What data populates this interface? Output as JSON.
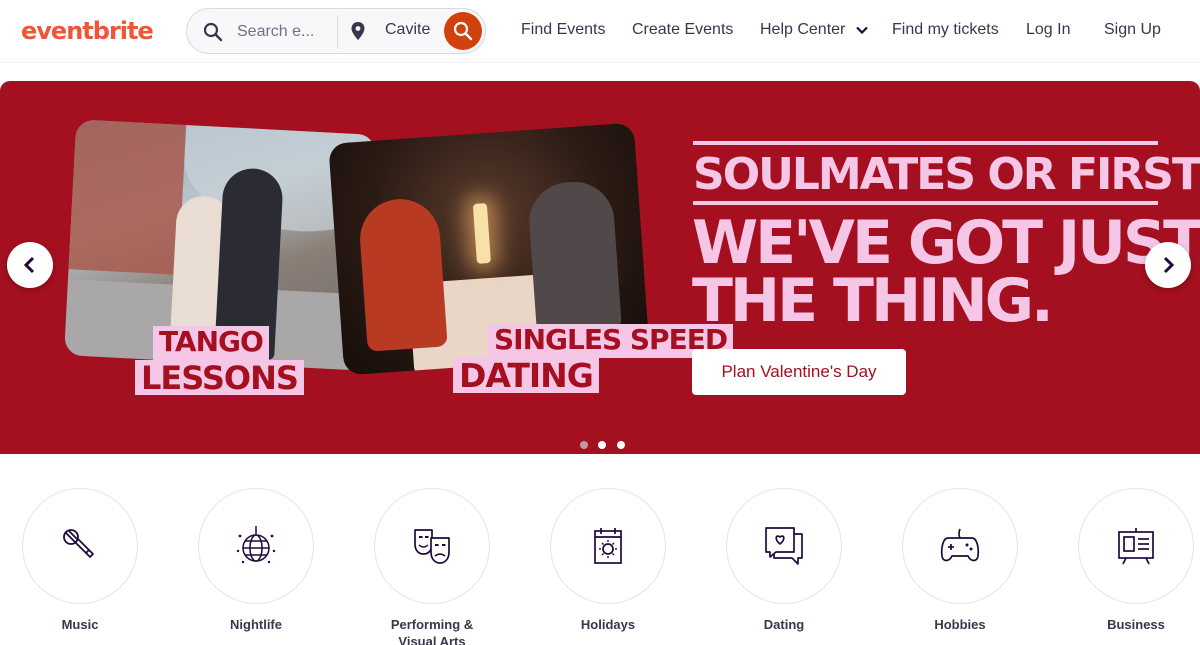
{
  "header": {
    "logo": "eventbrite",
    "search": {
      "placeholder": "Search e...",
      "location": "Cavite"
    },
    "nav": [
      {
        "label": "Find Events"
      },
      {
        "label": "Create Events"
      },
      {
        "label": "Help Center",
        "icon": "chevron-down-icon"
      },
      {
        "label": "Find my tickets"
      },
      {
        "label": "Log In"
      },
      {
        "label": "Sign Up"
      }
    ]
  },
  "hero": {
    "headline_top": "SOULMATES OR FIRST DATES",
    "headline_line1": "WE'VE GOT JUST",
    "headline_line2": "THE THING.",
    "stickers": {
      "tango_1": "TANGO",
      "tango_2": "LESSONS",
      "speed_1": "SINGLES SPEED",
      "speed_2": "DATING"
    },
    "cta_label": "Plan Valentine's Day",
    "slide_count": 3,
    "active_slide": 2
  },
  "categories": [
    {
      "label": "Music",
      "icon": "microphone-icon"
    },
    {
      "label": "Nightlife",
      "icon": "disco-ball-icon"
    },
    {
      "label": "Performing & Visual Arts",
      "icon": "theater-masks-icon"
    },
    {
      "label": "Holidays",
      "icon": "calendar-sun-icon"
    },
    {
      "label": "Dating",
      "icon": "chat-heart-icon"
    },
    {
      "label": "Hobbies",
      "icon": "gamepad-icon"
    },
    {
      "label": "Business",
      "icon": "presentation-board-icon"
    }
  ],
  "colors": {
    "brand": "#f05537",
    "hero_bg": "#a4101f",
    "hero_text": "#f6c6e7",
    "search_button": "#d1410c"
  }
}
